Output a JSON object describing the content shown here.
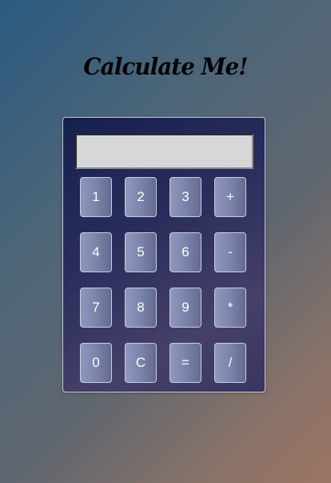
{
  "header": {
    "title": "Calculate Me!"
  },
  "display": {
    "value": ""
  },
  "keys": {
    "k1": "1",
    "k2": "2",
    "k3": "3",
    "plus": "+",
    "k4": "4",
    "k5": "5",
    "k6": "6",
    "minus": "-",
    "k7": "7",
    "k8": "8",
    "k9": "9",
    "multiply": "*",
    "k0": "0",
    "clear": "C",
    "equals": "=",
    "divide": "/"
  },
  "colors": {
    "calculator_body": "#15204f",
    "key_face": "#7d84ac",
    "display_bg": "#d6d7d8"
  }
}
